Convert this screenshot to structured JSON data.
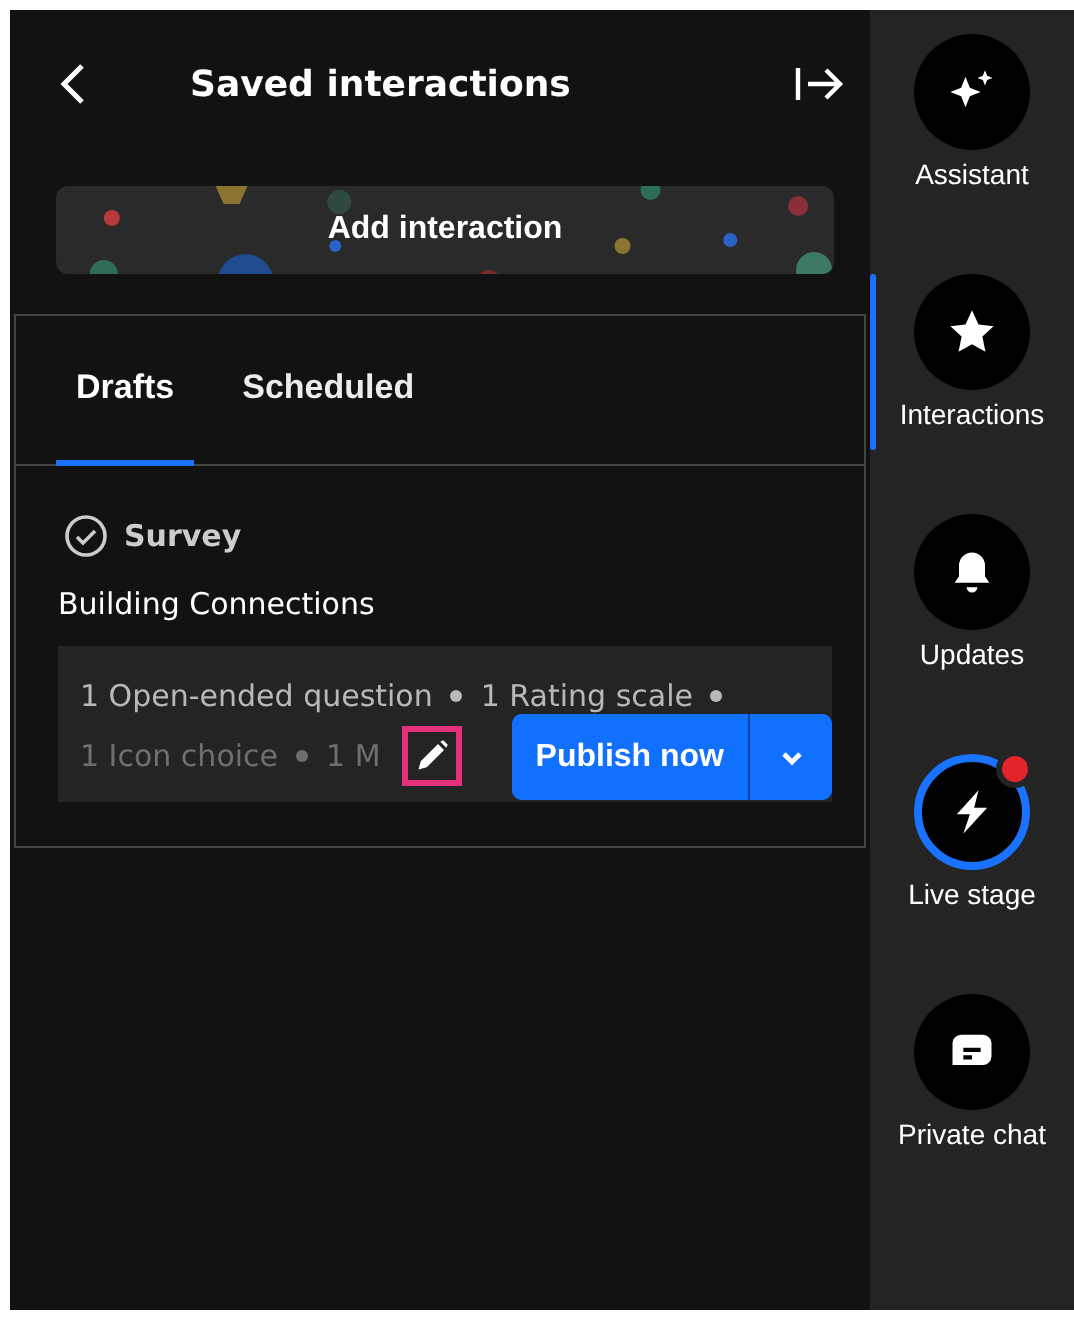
{
  "header": {
    "title": "Saved interactions"
  },
  "add_button": {
    "label": "Add interaction"
  },
  "tabs": [
    {
      "label": "Drafts",
      "selected": true
    },
    {
      "label": "Scheduled",
      "selected": false
    }
  ],
  "draft": {
    "type": "Survey",
    "title": "Building Connections",
    "summary_lines": [
      {
        "items": [
          "1 Open-ended question",
          "1 Rating scale"
        ],
        "trailing_dot": true
      },
      {
        "items": [
          "1 Icon choice",
          "1 M"
        ],
        "trailing_dot": false
      }
    ],
    "edit_highlighted": true,
    "publish": {
      "label": "Publish now"
    }
  },
  "sidebar": [
    {
      "kind": "sparkle",
      "label": "Assistant",
      "selected": false,
      "live": false,
      "notification": false
    },
    {
      "kind": "star",
      "label": "Interactions",
      "selected": true,
      "live": false,
      "notification": false
    },
    {
      "kind": "bell",
      "label": "Updates",
      "selected": false,
      "live": false,
      "notification": false
    },
    {
      "kind": "bolt",
      "label": "Live stage",
      "selected": false,
      "live": true,
      "notification": true
    },
    {
      "kind": "chat",
      "label": "Private chat",
      "selected": false,
      "live": false,
      "notification": false
    }
  ]
}
